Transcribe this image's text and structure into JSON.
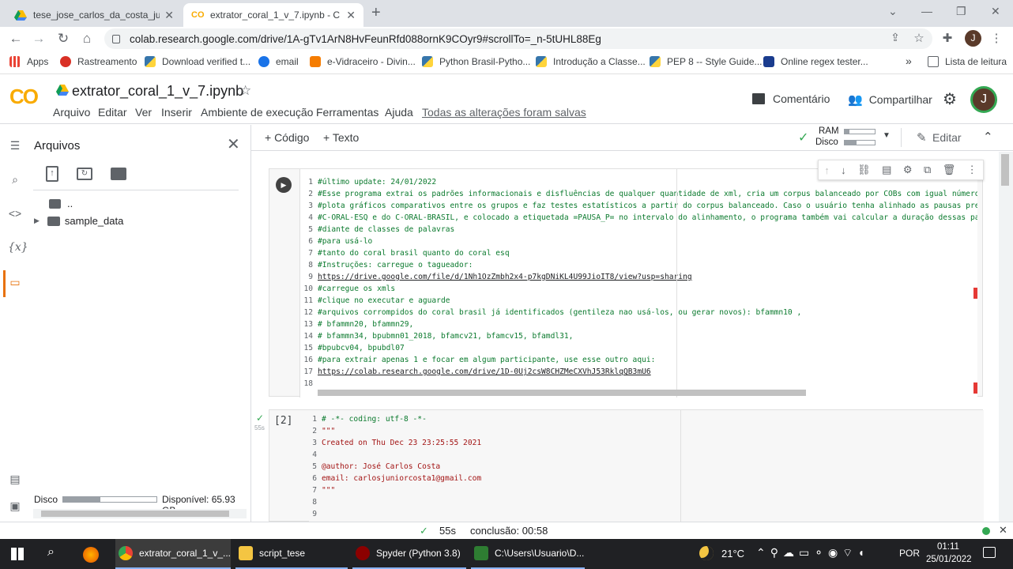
{
  "browser": {
    "tabs": [
      {
        "title": "tese_jose_carlos_da_costa_junior",
        "close": "✕"
      },
      {
        "title": "extrator_coral_1_v_7.ipynb - Cola",
        "close": "✕"
      }
    ],
    "new_tab": "+",
    "url": "colab.research.google.com/drive/1A-gTv1ArN8HvFeunRfd088ornK9COyr9#scrollTo=_n-5tUHL88Eg",
    "profile_initial": "J",
    "bookmarks": [
      {
        "label": "Apps",
        "color": "#ea4335"
      },
      {
        "label": "Rastreamento",
        "color": "#d93025"
      },
      {
        "label": "Download verified t...",
        "color": "#3776ab"
      },
      {
        "label": "email",
        "color": "#1a73e8"
      },
      {
        "label": "e-Vidraceiro - Divin...",
        "color": "#f57c00"
      },
      {
        "label": "Python Brasil-Pytho...",
        "color": "#3776ab"
      },
      {
        "label": "Introdução a Classe...",
        "color": "#3776ab"
      },
      {
        "label": "PEP 8 -- Style Guide...",
        "color": "#3776ab"
      },
      {
        "label": "Online regex tester...",
        "color": "#1a3c8e"
      }
    ],
    "bookmarks_more": "»",
    "reading_list": "Lista de leitura"
  },
  "colab": {
    "logo": "CO",
    "notebook_name": "extrator_coral_1_v_7.ipynb",
    "menus": [
      "Arquivo",
      "Editar",
      "Ver",
      "Inserir",
      "Ambiente de execução",
      "Ferramentas",
      "Ajuda"
    ],
    "save_status": "Todas as alterações foram salvas",
    "comment_label": "Comentário",
    "share_label": "Compartilhar",
    "avatar_initial": "J"
  },
  "sidebar": {
    "title": "Arquivos",
    "tree": [
      {
        "label": ".."
      },
      {
        "label": "sample_data"
      }
    ],
    "disk_label": "Disco",
    "disk_available": "Disponível: 65.93 GB",
    "disk_used_fraction": 0.4
  },
  "nbtoolbar": {
    "add_code": "+ Código",
    "add_text": "+ Texto",
    "ram_label": "RAM",
    "disk_label": "Disco",
    "edit_label": "Editar"
  },
  "cell1": {
    "lines": [
      "#último update: 24/01/2022",
      "#Esse programa extrai os padrões informacionais e disfluências de qualquer quantidade de xml, cria um corpus balanceado por COBs com igual número de",
      "#plota gráficos comparativos entre os grupos e faz testes estatísticos a partir do corpus balanceado. Caso o usuário tenha alinhado as pausas preen",
      "#C-ORAL-ESQ e do C-ORAL-BRASIL, e colocado a etiquetada =PAUSA_P= no intervalo do alinhamento, o programa também vai calcular a duração dessas pausa",
      "#diante de classes de palavras",
      "#para usá-lo",
      "#tanto do coral brasil quanto do coral esq",
      "#Instruções: carregue o tagueador:",
      "https://drive.google.com/file/d/1Nh1OzZmbh2x4-p7kgDNiKL4U99JioIT8/view?usp=sharing",
      "#carregue os xmls",
      "#clique no executar e aguarde",
      "#arquivos corrompidos do coral brasil já identificados (gentileza nao usá-los, ou gerar novos): bfammn10 ,",
      "# bfammn20, bfammn29,",
      "# bfammn34, bpubmn01_2018, bfamcv21, bfamcv15, bfamdl31,",
      "#bpubcv04, bpubdl07",
      "#para extrair apenas 1 e focar em algum participante, use esse outro aqui:",
      "https://colab.research.google.com/drive/1D-0Uj2csW8CHZMeCXVhJ53RklqQB3mU6",
      ""
    ]
  },
  "cell2": {
    "exec_count": "[2]",
    "time": "55s",
    "lines": [
      "# -*- coding: utf-8 -*-",
      "\"\"\"",
      "Created on Thu Dec 23 23:25:55 2021",
      "",
      "@author: José Carlos Costa",
      "email: carlosjuniorcosta1@gmail.com",
      "\"\"\"",
      "",
      ""
    ]
  },
  "status": {
    "elapsed": "55s",
    "conclusion": "conclusão: 00:58"
  },
  "taskbar": {
    "items": [
      {
        "label": "extrator_coral_1_v_...",
        "color": "#4285f4"
      },
      {
        "label": "script_tese",
        "color": "#f4c542"
      },
      {
        "label": "Spyder (Python 3.8)",
        "color": "#8b0000"
      },
      {
        "label": "C:\\Users\\Usuario\\D...",
        "color": "#2e7d32"
      }
    ],
    "temperature": "21°C",
    "language": "POR",
    "time": "01:11",
    "date": "25/01/2022"
  }
}
